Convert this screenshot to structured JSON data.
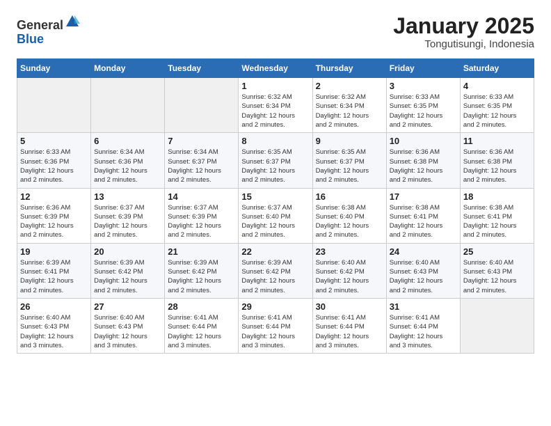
{
  "logo": {
    "general": "General",
    "blue": "Blue"
  },
  "title": "January 2025",
  "subtitle": "Tongutisungi, Indonesia",
  "days_of_week": [
    "Sunday",
    "Monday",
    "Tuesday",
    "Wednesday",
    "Thursday",
    "Friday",
    "Saturday"
  ],
  "weeks": [
    [
      {
        "day": "",
        "info": ""
      },
      {
        "day": "",
        "info": ""
      },
      {
        "day": "",
        "info": ""
      },
      {
        "day": "1",
        "info": "Sunrise: 6:32 AM\nSunset: 6:34 PM\nDaylight: 12 hours\nand 2 minutes."
      },
      {
        "day": "2",
        "info": "Sunrise: 6:32 AM\nSunset: 6:34 PM\nDaylight: 12 hours\nand 2 minutes."
      },
      {
        "day": "3",
        "info": "Sunrise: 6:33 AM\nSunset: 6:35 PM\nDaylight: 12 hours\nand 2 minutes."
      },
      {
        "day": "4",
        "info": "Sunrise: 6:33 AM\nSunset: 6:35 PM\nDaylight: 12 hours\nand 2 minutes."
      }
    ],
    [
      {
        "day": "5",
        "info": "Sunrise: 6:33 AM\nSunset: 6:36 PM\nDaylight: 12 hours\nand 2 minutes."
      },
      {
        "day": "6",
        "info": "Sunrise: 6:34 AM\nSunset: 6:36 PM\nDaylight: 12 hours\nand 2 minutes."
      },
      {
        "day": "7",
        "info": "Sunrise: 6:34 AM\nSunset: 6:37 PM\nDaylight: 12 hours\nand 2 minutes."
      },
      {
        "day": "8",
        "info": "Sunrise: 6:35 AM\nSunset: 6:37 PM\nDaylight: 12 hours\nand 2 minutes."
      },
      {
        "day": "9",
        "info": "Sunrise: 6:35 AM\nSunset: 6:37 PM\nDaylight: 12 hours\nand 2 minutes."
      },
      {
        "day": "10",
        "info": "Sunrise: 6:36 AM\nSunset: 6:38 PM\nDaylight: 12 hours\nand 2 minutes."
      },
      {
        "day": "11",
        "info": "Sunrise: 6:36 AM\nSunset: 6:38 PM\nDaylight: 12 hours\nand 2 minutes."
      }
    ],
    [
      {
        "day": "12",
        "info": "Sunrise: 6:36 AM\nSunset: 6:39 PM\nDaylight: 12 hours\nand 2 minutes."
      },
      {
        "day": "13",
        "info": "Sunrise: 6:37 AM\nSunset: 6:39 PM\nDaylight: 12 hours\nand 2 minutes."
      },
      {
        "day": "14",
        "info": "Sunrise: 6:37 AM\nSunset: 6:39 PM\nDaylight: 12 hours\nand 2 minutes."
      },
      {
        "day": "15",
        "info": "Sunrise: 6:37 AM\nSunset: 6:40 PM\nDaylight: 12 hours\nand 2 minutes."
      },
      {
        "day": "16",
        "info": "Sunrise: 6:38 AM\nSunset: 6:40 PM\nDaylight: 12 hours\nand 2 minutes."
      },
      {
        "day": "17",
        "info": "Sunrise: 6:38 AM\nSunset: 6:41 PM\nDaylight: 12 hours\nand 2 minutes."
      },
      {
        "day": "18",
        "info": "Sunrise: 6:38 AM\nSunset: 6:41 PM\nDaylight: 12 hours\nand 2 minutes."
      }
    ],
    [
      {
        "day": "19",
        "info": "Sunrise: 6:39 AM\nSunset: 6:41 PM\nDaylight: 12 hours\nand 2 minutes."
      },
      {
        "day": "20",
        "info": "Sunrise: 6:39 AM\nSunset: 6:42 PM\nDaylight: 12 hours\nand 2 minutes."
      },
      {
        "day": "21",
        "info": "Sunrise: 6:39 AM\nSunset: 6:42 PM\nDaylight: 12 hours\nand 2 minutes."
      },
      {
        "day": "22",
        "info": "Sunrise: 6:39 AM\nSunset: 6:42 PM\nDaylight: 12 hours\nand 2 minutes."
      },
      {
        "day": "23",
        "info": "Sunrise: 6:40 AM\nSunset: 6:42 PM\nDaylight: 12 hours\nand 2 minutes."
      },
      {
        "day": "24",
        "info": "Sunrise: 6:40 AM\nSunset: 6:43 PM\nDaylight: 12 hours\nand 2 minutes."
      },
      {
        "day": "25",
        "info": "Sunrise: 6:40 AM\nSunset: 6:43 PM\nDaylight: 12 hours\nand 2 minutes."
      }
    ],
    [
      {
        "day": "26",
        "info": "Sunrise: 6:40 AM\nSunset: 6:43 PM\nDaylight: 12 hours\nand 3 minutes."
      },
      {
        "day": "27",
        "info": "Sunrise: 6:40 AM\nSunset: 6:43 PM\nDaylight: 12 hours\nand 3 minutes."
      },
      {
        "day": "28",
        "info": "Sunrise: 6:41 AM\nSunset: 6:44 PM\nDaylight: 12 hours\nand 3 minutes."
      },
      {
        "day": "29",
        "info": "Sunrise: 6:41 AM\nSunset: 6:44 PM\nDaylight: 12 hours\nand 3 minutes."
      },
      {
        "day": "30",
        "info": "Sunrise: 6:41 AM\nSunset: 6:44 PM\nDaylight: 12 hours\nand 3 minutes."
      },
      {
        "day": "31",
        "info": "Sunrise: 6:41 AM\nSunset: 6:44 PM\nDaylight: 12 hours\nand 3 minutes."
      },
      {
        "day": "",
        "info": ""
      }
    ]
  ]
}
